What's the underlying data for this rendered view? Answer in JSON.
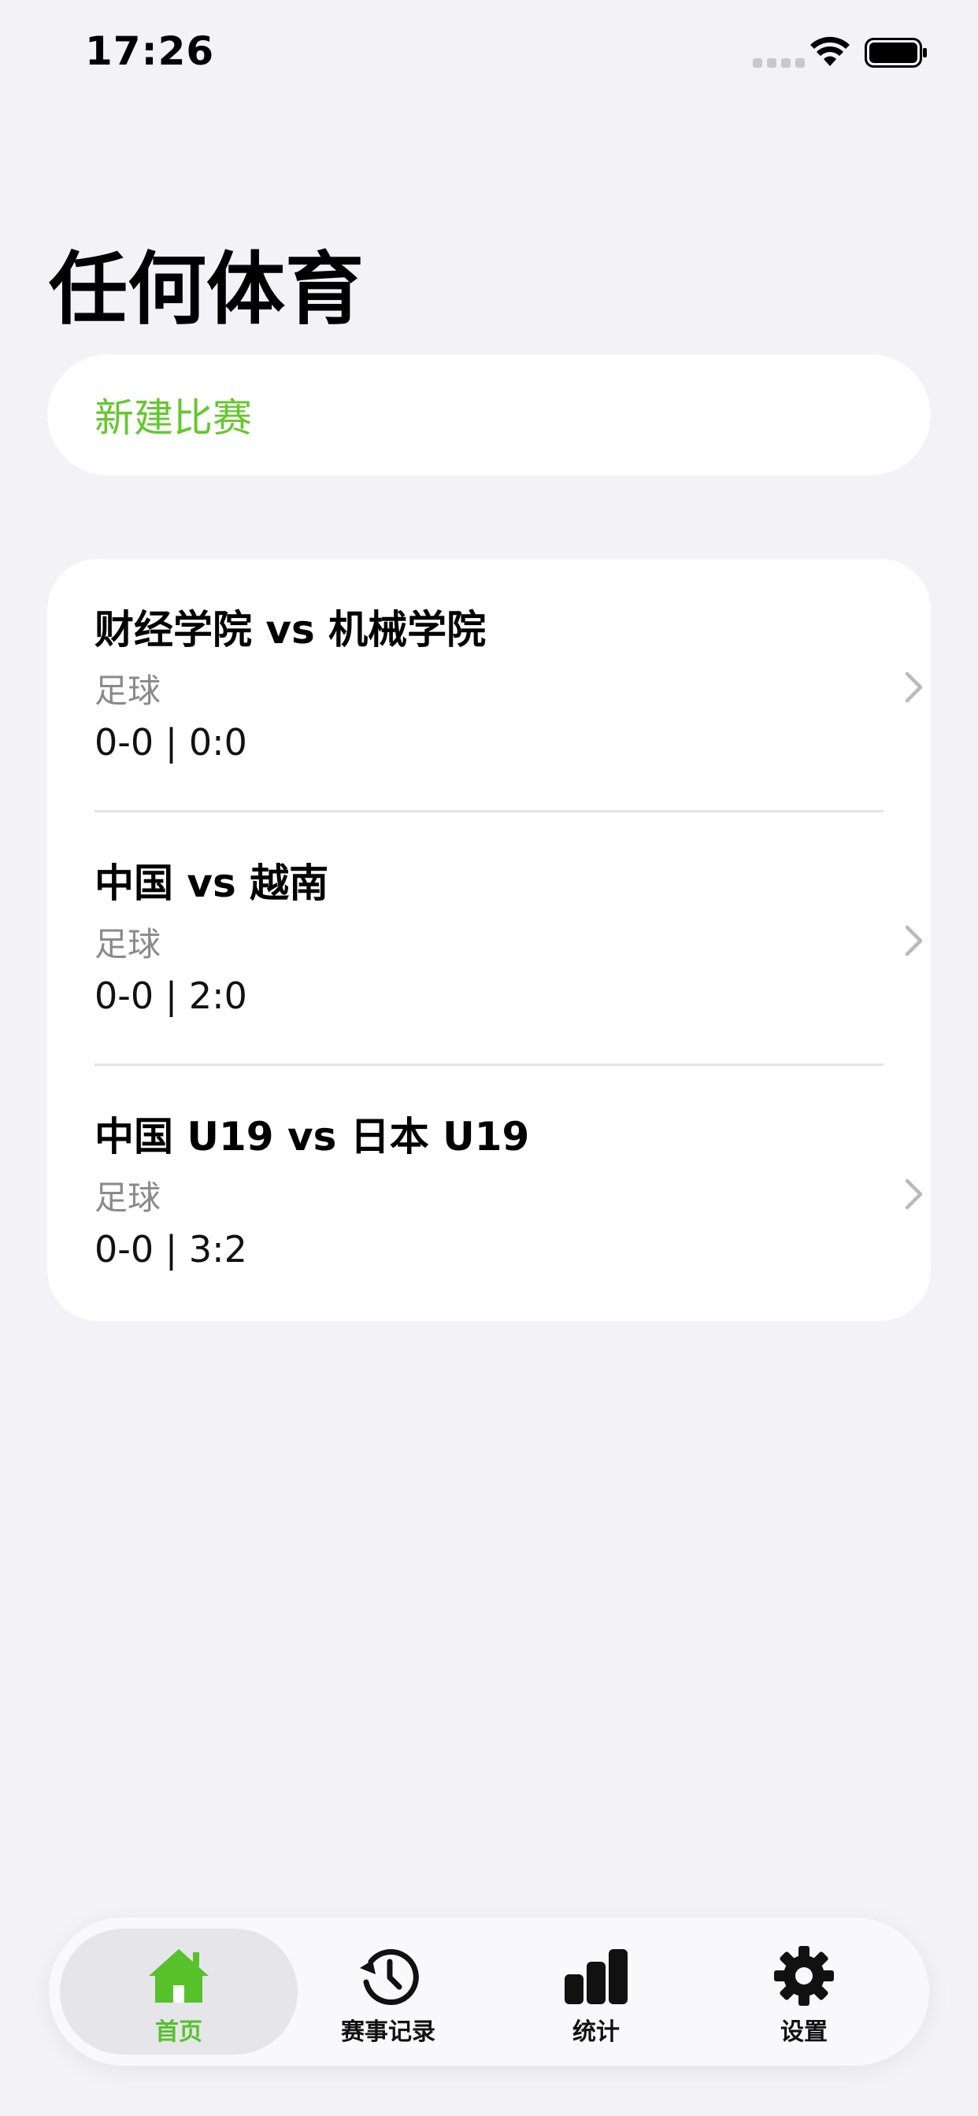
{
  "status_bar": {
    "time": "17:26"
  },
  "page": {
    "title": "任何体育"
  },
  "new_match": {
    "label": "新建比赛",
    "color": "#65c72e"
  },
  "matches": [
    {
      "title": "财经学院 vs 机械学院",
      "sport": "足球",
      "score": "0-0 | 0:0"
    },
    {
      "title": "中国 vs 越南",
      "sport": "足球",
      "score": "0-0 | 2:0"
    },
    {
      "title": "中国 U19 vs 日本 U19",
      "sport": "足球",
      "score": "0-0 | 3:2"
    }
  ],
  "tab_bar": {
    "items": [
      {
        "label": "首页",
        "icon": "home-icon",
        "active": true
      },
      {
        "label": "赛事记录",
        "icon": "history-icon",
        "active": false
      },
      {
        "label": "统计",
        "icon": "bar-chart-icon",
        "active": false
      },
      {
        "label": "设置",
        "icon": "gear-icon",
        "active": false
      }
    ],
    "accent_color": "#57c22c"
  }
}
